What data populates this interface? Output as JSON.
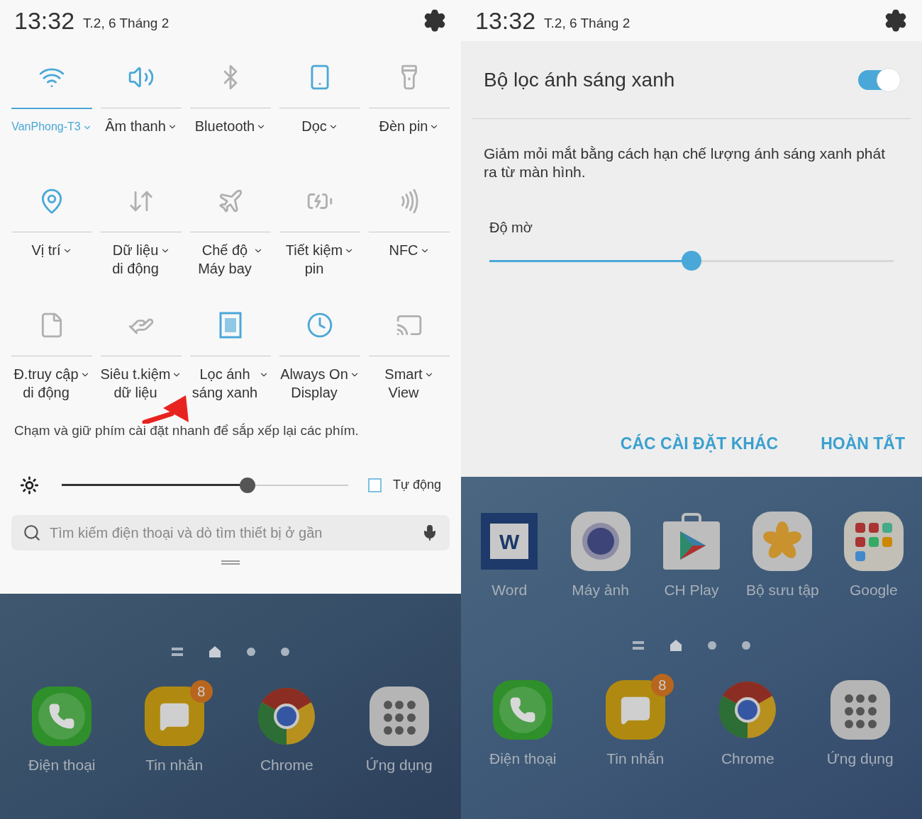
{
  "left_screen": {
    "status_bar": {
      "time": "13:32",
      "date": "T.2, 6 Tháng 2"
    },
    "quick_tiles": [
      {
        "kind": "wifi",
        "label_lines": [
          "VanPhong-T3"
        ],
        "on": true,
        "highlighted": true
      },
      {
        "kind": "sound",
        "label_lines": [
          "Âm thanh"
        ],
        "on": true,
        "highlighted": false
      },
      {
        "kind": "bluetooth",
        "label_lines": [
          "Bluetooth"
        ],
        "on": false,
        "highlighted": false
      },
      {
        "kind": "portrait",
        "label_lines": [
          "Dọc"
        ],
        "on": true,
        "highlighted": false
      },
      {
        "kind": "flashlight",
        "label_lines": [
          "Đèn pin"
        ],
        "on": false,
        "highlighted": false
      },
      {
        "kind": "location",
        "label_lines": [
          "Vị trí"
        ],
        "on": true,
        "highlighted": false
      },
      {
        "kind": "data",
        "label_lines": [
          "Dữ liệu",
          "di động"
        ],
        "on": false,
        "highlighted": false
      },
      {
        "kind": "airplane",
        "label_lines": [
          "Chế độ",
          "Máy bay"
        ],
        "on": false,
        "highlighted": false
      },
      {
        "kind": "battery",
        "label_lines": [
          "Tiết kiệm",
          "pin"
        ],
        "on": false,
        "highlighted": false
      },
      {
        "kind": "nfc",
        "label_lines": [
          "NFC"
        ],
        "on": false,
        "highlighted": false
      },
      {
        "kind": "hotspot",
        "label_lines": [
          "Đ.truy cập",
          "di động"
        ],
        "on": false,
        "highlighted": false
      },
      {
        "kind": "datasaver",
        "label_lines": [
          "Siêu t.kiệm",
          "dữ liệu"
        ],
        "on": false,
        "highlighted": false
      },
      {
        "kind": "bluelight",
        "label_lines": [
          "Lọc ánh",
          "sáng xanh"
        ],
        "on": true,
        "highlighted": false
      },
      {
        "kind": "alwayson",
        "label_lines": [
          "Always On",
          "Display"
        ],
        "on": true,
        "highlighted": false
      },
      {
        "kind": "smartview",
        "label_lines": [
          "Smart",
          "View"
        ],
        "on": false,
        "highlighted": false
      }
    ],
    "hint": "Chạm và giữ phím cài đặt nhanh để sắp xếp lại các phím.",
    "brightness": {
      "level": 0.65,
      "auto_label": "Tự động",
      "auto_checked": false
    },
    "search": {
      "placeholder": "Tìm kiếm điện thoại và dò tìm thiết bị ở gần"
    },
    "home": {
      "dock": [
        {
          "kind": "phone",
          "label": "Điện thoại"
        },
        {
          "kind": "messages",
          "label": "Tin nhắn",
          "badge": "8"
        },
        {
          "kind": "chrome",
          "label": "Chrome"
        },
        {
          "kind": "apps",
          "label": "Ứng dụng"
        }
      ]
    }
  },
  "right_screen": {
    "status_bar": {
      "time": "13:32",
      "date": "T.2, 6 Tháng 2"
    },
    "dialog": {
      "title": "Bộ lọc ánh sáng xanh",
      "on": true,
      "description": "Giảm mỏi mắt bằng cách hạn chế lượng ánh sáng xanh phát ra từ màn hình.",
      "opacity": {
        "label": "Độ mờ",
        "level": 0.5
      },
      "buttons": [
        "CÁC CÀI ĐẶT KHÁC",
        "HOÀN TẤT"
      ]
    },
    "home": {
      "apps": [
        {
          "kind": "word",
          "label": "Word",
          "glyph": "W"
        },
        {
          "kind": "camera",
          "label": "Máy ảnh"
        },
        {
          "kind": "play",
          "label": "CH Play"
        },
        {
          "kind": "gallery",
          "label": "Bộ sưu tập"
        },
        {
          "kind": "folder",
          "label": "Google"
        }
      ],
      "dock": [
        {
          "kind": "phone",
          "label": "Điện thoại"
        },
        {
          "kind": "messages",
          "label": "Tin nhắn",
          "badge": "8"
        },
        {
          "kind": "chrome",
          "label": "Chrome"
        },
        {
          "kind": "apps",
          "label": "Ứng dụng"
        }
      ]
    }
  }
}
